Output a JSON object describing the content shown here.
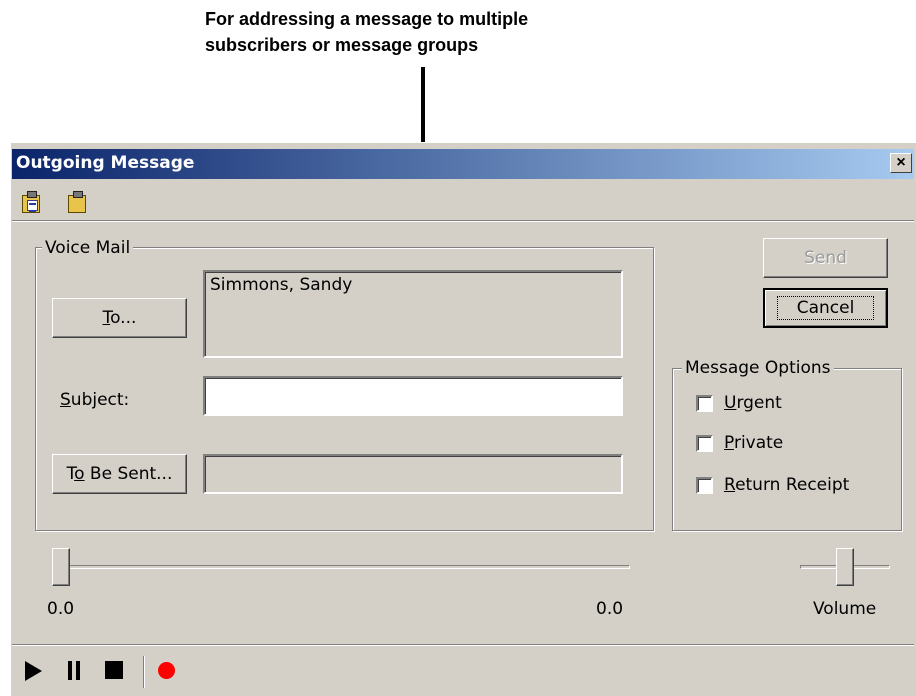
{
  "callout": {
    "line1": "For addressing a message to multiple",
    "line2": "subscribers or message groups"
  },
  "window": {
    "title": "Outgoing Message",
    "close_glyph": "×"
  },
  "toolbar": {
    "icons": [
      "paste-clipboard-icon",
      "clipboard-icon"
    ]
  },
  "voice_mail": {
    "legend": "Voice Mail",
    "to_button": {
      "pre": "",
      "ul": "T",
      "post": "o..."
    },
    "recipients": "Simmons, Sandy",
    "subject_label": {
      "pre": "",
      "ul": "S",
      "post": "ubject:"
    },
    "subject_value": "",
    "to_be_sent_button": {
      "pre": "T",
      "ul": "o",
      "post": " Be Sent..."
    },
    "to_be_sent_value": ""
  },
  "buttons": {
    "send": "Send",
    "cancel": "Cancel"
  },
  "message_options": {
    "legend": "Message Options",
    "urgent": {
      "ul": "U",
      "post": "rgent",
      "checked": false
    },
    "private": {
      "ul": "P",
      "post": "rivate",
      "checked": false
    },
    "return_receipt": {
      "ul": "R",
      "post": "eturn Receipt",
      "checked": false
    }
  },
  "position": {
    "start": "0.0",
    "end": "0.0",
    "value": 0
  },
  "volume": {
    "label": "Volume",
    "level": 0.5
  },
  "controls": [
    "play-icon",
    "pause-icon",
    "stop-icon",
    "record-icon"
  ],
  "colors": {
    "title_start": "#0a246a",
    "title_end": "#a6caf0",
    "face": "#d4d0c8",
    "record": "#ff0000"
  }
}
